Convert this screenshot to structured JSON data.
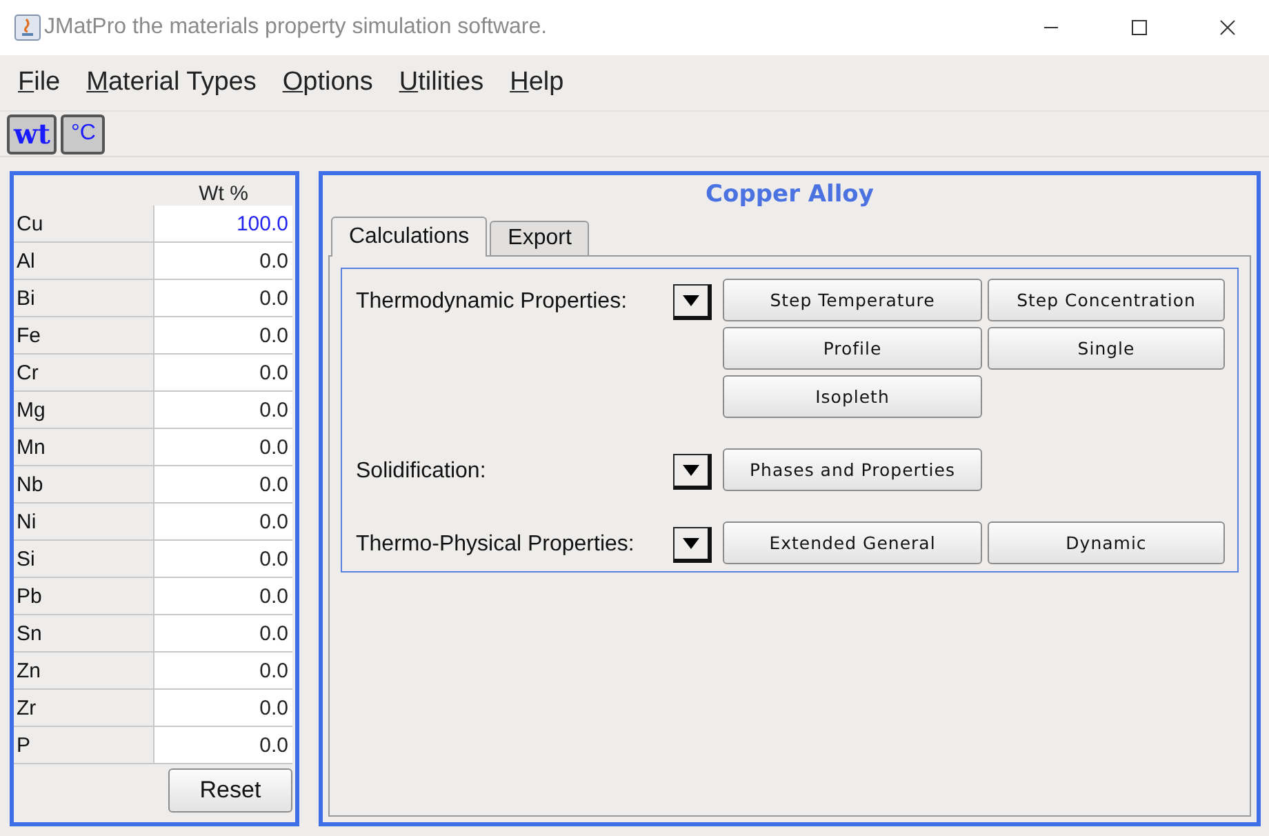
{
  "window": {
    "title": "JMatPro the materials property simulation software."
  },
  "menu": [
    "File",
    "Material Types",
    "Options",
    "Utilities",
    "Help"
  ],
  "toolbar": [
    {
      "label": "wt",
      "kind": "bold"
    },
    {
      "label": "°C",
      "kind": "plain"
    }
  ],
  "composition": {
    "header": "Wt %",
    "rows": [
      {
        "element": "Cu",
        "value": "100.0",
        "highlighted": true
      },
      {
        "element": "Al",
        "value": "0.0",
        "highlighted": false
      },
      {
        "element": "Bi",
        "value": "0.0",
        "highlighted": false
      },
      {
        "element": "Fe",
        "value": "0.0",
        "highlighted": false
      },
      {
        "element": "Cr",
        "value": "0.0",
        "highlighted": false
      },
      {
        "element": "Mg",
        "value": "0.0",
        "highlighted": false
      },
      {
        "element": "Mn",
        "value": "0.0",
        "highlighted": false
      },
      {
        "element": "Nb",
        "value": "0.0",
        "highlighted": false
      },
      {
        "element": "Ni",
        "value": "0.0",
        "highlighted": false
      },
      {
        "element": "Si",
        "value": "0.0",
        "highlighted": false
      },
      {
        "element": "Pb",
        "value": "0.0",
        "highlighted": false
      },
      {
        "element": "Sn",
        "value": "0.0",
        "highlighted": false
      },
      {
        "element": "Zn",
        "value": "0.0",
        "highlighted": false
      },
      {
        "element": "Zr",
        "value": "0.0",
        "highlighted": false
      },
      {
        "element": "P",
        "value": "0.0",
        "highlighted": false
      }
    ],
    "reset": "Reset"
  },
  "main": {
    "title": "Copper Alloy",
    "tabs": [
      {
        "label": "Calculations",
        "selected": true
      },
      {
        "label": "Export",
        "selected": false
      }
    ],
    "sections": [
      {
        "label": "Thermodynamic Properties:",
        "buttons": [
          "Step Temperature",
          "Step Concentration",
          "Profile",
          "Single",
          "Isopleth"
        ]
      },
      {
        "label": "Solidification:",
        "buttons": [
          "Phases and Properties"
        ]
      },
      {
        "label": "Thermo-Physical Properties:",
        "buttons": [
          "Extended General",
          "Dynamic"
        ]
      }
    ]
  }
}
